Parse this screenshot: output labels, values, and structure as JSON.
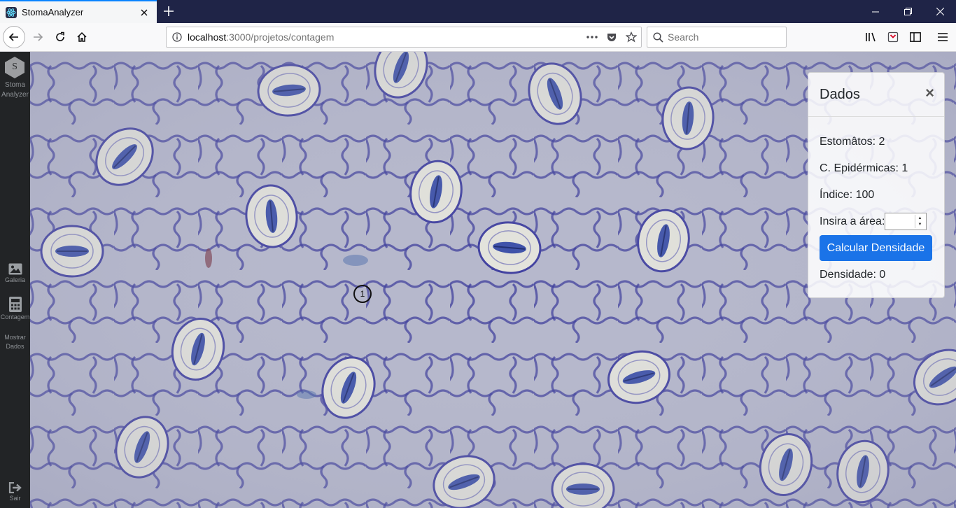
{
  "browser": {
    "tab_title": "StomaAnalyzer",
    "url_host": "localhost",
    "url_path": ":3000/projetos/contagem",
    "search_placeholder": "Search"
  },
  "sidebar": {
    "logo_letter": "S",
    "logo_line1": "Stoma",
    "logo_line2": "Analyzer",
    "items": [
      {
        "label": "Galeria",
        "icon": "image-icon"
      },
      {
        "label": "Contagem",
        "icon": "calculator-icon"
      },
      {
        "label_line1": "Mostrar",
        "label_line2": "Dados"
      },
      {
        "label": "Sair",
        "icon": "sign-out-icon"
      }
    ]
  },
  "canvas": {
    "marker_label": "1"
  },
  "panel": {
    "title": "Dados",
    "close": "×",
    "estomatos": "Estomâtos: 2",
    "epidermicas": "C. Epidérmicas: 1",
    "indice": "Índice: 100",
    "area_label": "Insira a área:",
    "area_value": "",
    "calc_button": "Calcular Densidade",
    "densidade": "Densidade: 0"
  },
  "colors": {
    "accent": "#1a73e8",
    "tab_highlight": "#0a84ff",
    "titlebar": "#1f2447",
    "sidebar": "#222426"
  }
}
